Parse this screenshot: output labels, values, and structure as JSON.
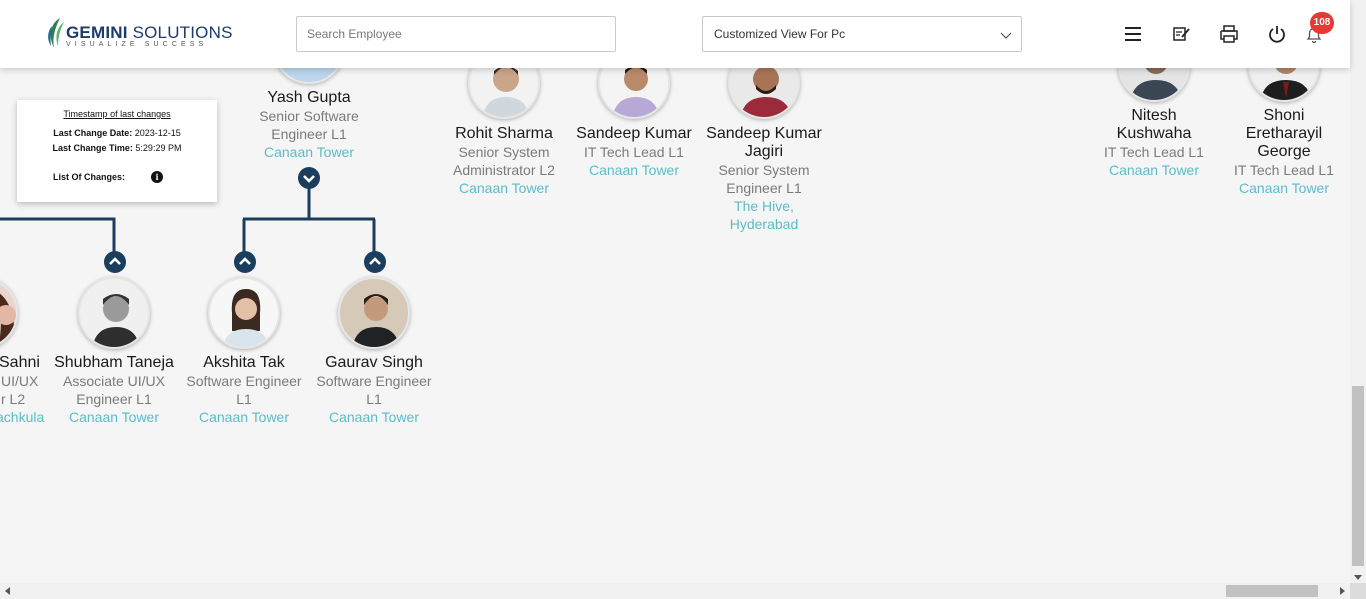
{
  "header": {
    "logo_title_bold": "GEMINI",
    "logo_title_rest": " SOLUTIONS",
    "logo_subtitle": "VISUALIZE SUCCESS",
    "search_placeholder": "Search Employee",
    "view_select_value": "Customized View For Pc",
    "notification_count": "108",
    "icons": [
      "menu-icon",
      "edit-note-icon",
      "print-icon",
      "power-icon",
      "bell-icon"
    ]
  },
  "timestamp_card": {
    "title": "Timestamp of last changes",
    "date_label": "Last Change Date:",
    "date_value": "2023-12-15",
    "time_label": "Last Change Time:",
    "time_value": "5:29:29 PM",
    "changes_label": "List Of Changes:"
  },
  "people": [
    {
      "name": "Yash Gupta",
      "role": "Senior Software Engineer L1",
      "location": "Canaan Tower"
    },
    {
      "name": "Rohit Sharma",
      "role": "Senior System Administrator L2",
      "location": "Canaan Tower"
    },
    {
      "name": "Sandeep Kumar",
      "role": "IT Tech Lead L1",
      "location": "Canaan Tower"
    },
    {
      "name": "Sandeep Kumar Jagiri",
      "role": "Senior System Engineer L1",
      "location": "The Hive, Hyderabad"
    },
    {
      "name": "Nitesh Kushwaha",
      "role": "IT Tech Lead L1",
      "location": "Canaan Tower"
    },
    {
      "name": "Shoni Eretharayil George",
      "role": "IT Tech Lead L1",
      "location": "Canaan Tower"
    },
    {
      "name": "Sahni",
      "role": "UI/UX",
      "role2": "r L2",
      "location": "achkula"
    },
    {
      "name": "Shubham Taneja",
      "role": "Associate UI/UX Engineer L1",
      "location": "Canaan Tower"
    },
    {
      "name": "Akshita Tak",
      "role": "Software Engineer L1",
      "location": "Canaan Tower"
    },
    {
      "name": "Gaurav Singh",
      "role": "Software Engineer L1",
      "location": "Canaan Tower"
    }
  ],
  "colors": {
    "connector": "#1b3e5e",
    "location_link": "#5bbcc8",
    "badge": "#e53935"
  }
}
